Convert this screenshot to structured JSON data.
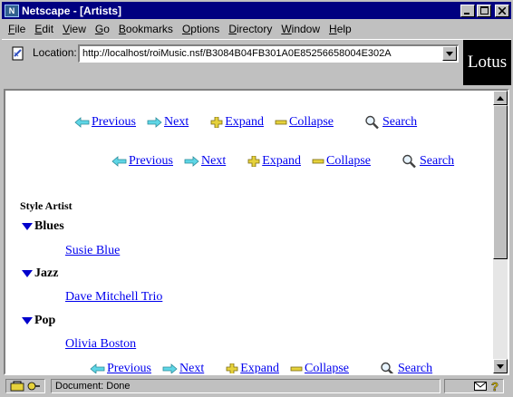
{
  "window": {
    "title": "Netscape - [Artists]",
    "app_icon_glyph": "N"
  },
  "menubar": {
    "items": [
      {
        "key": "F",
        "rest": "ile"
      },
      {
        "key": "E",
        "rest": "dit"
      },
      {
        "key": "V",
        "rest": "iew"
      },
      {
        "key": "G",
        "rest": "o"
      },
      {
        "key": "B",
        "rest": "ookmarks"
      },
      {
        "key": "O",
        "rest": "ptions"
      },
      {
        "key": "D",
        "rest": "irectory"
      },
      {
        "key": "W",
        "rest": "indow"
      },
      {
        "key": "H",
        "rest": "elp"
      }
    ]
  },
  "location": {
    "label": "Location:",
    "url": "http://localhost/roiMusic.nsf/B3084B04FB301A0E85256658004E302A",
    "logo_text": "Lotus"
  },
  "nav": {
    "previous": "Previous",
    "next": "Next",
    "expand": "Expand",
    "collapse": "Collapse",
    "search": "Search"
  },
  "view": {
    "column_header": "Style  Artist",
    "categories": [
      {
        "name": "Blues",
        "docs": [
          "Susie Blue"
        ]
      },
      {
        "name": "Jazz",
        "docs": [
          "Dave Mitchell Trio"
        ]
      },
      {
        "name": "Pop",
        "docs": [
          "Olivia Boston"
        ]
      }
    ]
  },
  "status": {
    "text": "Document: Done"
  },
  "colors": {
    "titlebar": "#000080",
    "link": "#0000ee",
    "arrow": "#5fd6e6",
    "expand_plus": "#e6d23c",
    "twisty": "#0000cc"
  }
}
